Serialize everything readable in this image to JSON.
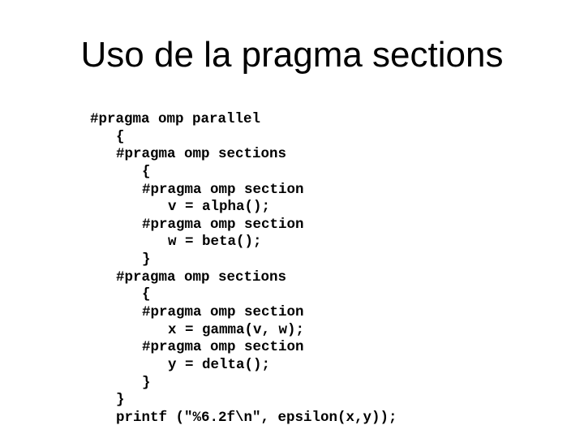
{
  "slide": {
    "title": "Uso de la pragma sections",
    "code_lines": [
      {
        "indent": 0,
        "text": "#pragma omp parallel"
      },
      {
        "indent": 1,
        "text": "{"
      },
      {
        "indent": 1,
        "text": "#pragma omp sections"
      },
      {
        "indent": 2,
        "text": "{"
      },
      {
        "indent": 2,
        "text": "#pragma omp section"
      },
      {
        "indent": 3,
        "text": "v = alpha();"
      },
      {
        "indent": 2,
        "text": "#pragma omp section"
      },
      {
        "indent": 3,
        "text": "w = beta();"
      },
      {
        "indent": 2,
        "text": "}"
      },
      {
        "indent": 1,
        "text": "#pragma omp sections"
      },
      {
        "indent": 2,
        "text": "{"
      },
      {
        "indent": 2,
        "text": "#pragma omp section"
      },
      {
        "indent": 3,
        "text": "x = gamma(v, w);"
      },
      {
        "indent": 2,
        "text": "#pragma omp section"
      },
      {
        "indent": 3,
        "text": "y = delta();"
      },
      {
        "indent": 2,
        "text": "}"
      },
      {
        "indent": 1,
        "text": "}"
      },
      {
        "indent": 1,
        "text": "printf (\"%6.2f\\n\", epsilon(x,y));"
      }
    ]
  }
}
